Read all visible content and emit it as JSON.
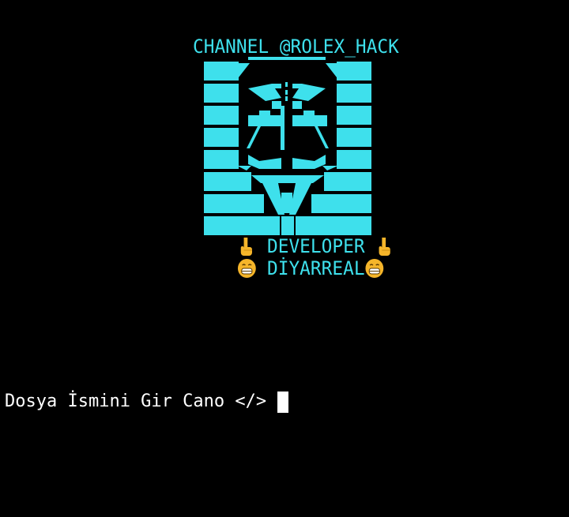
{
  "terminal": {
    "banner_title": "CHANNEL @ROLEX_HACK",
    "developer_label": "DEVELOPER",
    "developer_name": "DİYARREAL",
    "prompt_text": "Dosya İsmini Gir Cano </>",
    "left_hand_icon": "pointing-down-hand-icon",
    "right_hand_icon": "pointing-down-hand-icon",
    "left_face_icon": "grinning-face-icon",
    "right_face_icon": "grinning-face-icon"
  },
  "colors": {
    "background": "#000000",
    "banner_cyan": "#3ee0ec",
    "prompt_text": "#ffffff",
    "emoji_yellow": "#f5b52a"
  }
}
